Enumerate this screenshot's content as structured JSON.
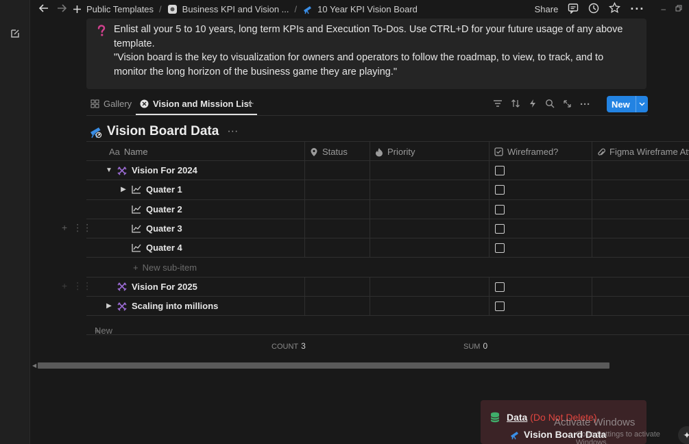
{
  "topbar": {
    "breadcrumbs": [
      {
        "label": "Public Templates",
        "icon": "plus-icon"
      },
      {
        "label": "Business KPI and Vision ...",
        "icon": "page-icon"
      },
      {
        "label": "10 Year KPI Vision Board",
        "icon": "telescope-icon"
      }
    ],
    "share_label": "Share"
  },
  "callout": {
    "icon": "question-mark-icon",
    "line1": "Enlist all your 5 to 10 years, long term KPIs and Execution To-Dos. Use CTRL+D for your future usage of any above template.",
    "line2": "\"Vision board is the key to visualization for owners and operators to follow the roadmap, to view, to track, and to monitor the long horizon of the business game they are playing.\""
  },
  "views": {
    "tabs": [
      {
        "label": "Gallery",
        "icon": "gallery-icon"
      },
      {
        "label": "Vision and Mission List",
        "icon": "list-icon",
        "active": true
      }
    ],
    "new_label": "New"
  },
  "database": {
    "title": "Vision Board Data",
    "dots": "···",
    "columns": {
      "name": "Name",
      "name_prefix": "Aa",
      "status": "Status",
      "priority": "Priority",
      "wireframed": "Wireframed?",
      "figma": "Figma Wireframe Atta"
    },
    "rows": [
      {
        "name": "Vision For 2024",
        "toggle": "▼"
      },
      {
        "name": "Quater 1",
        "toggle": "▶"
      },
      {
        "name": "Quater 2",
        "toggle": ""
      },
      {
        "name": "Quater 3",
        "toggle": ""
      },
      {
        "name": "Quater 4",
        "toggle": ""
      },
      {
        "name": "Vision For 2025",
        "toggle": ""
      },
      {
        "name": "Scaling into millions",
        "toggle": "▶"
      }
    ],
    "new_sub_item": "New sub-item",
    "new_row": "New",
    "count_label": "COUNT",
    "count_value": "3",
    "sum_label": "SUM",
    "sum_value": "0"
  },
  "panel": {
    "title": "Data",
    "title_red": "(Do Not Delete)",
    "link": "Vision Board Data"
  },
  "watermark": {
    "line1": "Activate Windows",
    "line2": "Go to Settings to activate Windows."
  },
  "colors": {
    "accent": "#2383e2",
    "purple_icon": "#9b6bd3",
    "blue_icon": "#3a8ee6",
    "red_text": "#e0453f",
    "green_icon": "#3fae6a"
  }
}
